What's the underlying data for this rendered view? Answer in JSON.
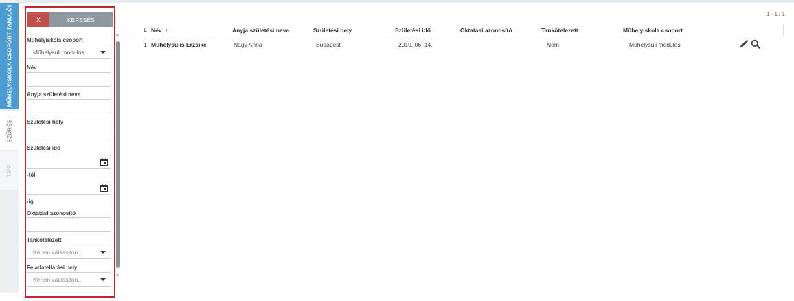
{
  "tabs": [
    {
      "label": "MŰHELYISKOLA CSOPORT TANULÓI"
    },
    {
      "label": "SZŰRÉS"
    },
    {
      "label": "TIPP"
    }
  ],
  "filter": {
    "clear_label": "X",
    "search_label": "KERESÉS",
    "group_label": "Műhelyiskola csoport",
    "group_value": "Műhelysuli modulos",
    "name_label": "Név",
    "mother_label": "Anyja születési neve",
    "birthplace_label": "Születési hely",
    "birthdate_label": "Születési idő",
    "from_label": "-tól",
    "to_label": "-ig",
    "eduid_label": "Oktatási azonosító",
    "compulsory_label": "Tankötelezett",
    "compulsory_placeholder": "Kérem válasszon...",
    "site_label": "Feladatellátási hely",
    "site_placeholder": "Kérem válasszon..."
  },
  "pager": "1 - 1 / 1",
  "table": {
    "headers": {
      "index": "#",
      "name": "Név",
      "sort_indicator": "↑",
      "mother": "Anyja születési neve",
      "birthplace": "Születési hely",
      "birthdate": "Születési idő",
      "eduid": "Oktatási azonosító",
      "compulsory": "Tankötelezett",
      "group": "Műhelyiskola csoport"
    },
    "rows": [
      {
        "index": "1",
        "name": "Műhelysulis Erzsike",
        "mother": "Nagy Anna",
        "birthplace": "Budapest",
        "birthdate": "2010. 06. 14.",
        "eduid": "",
        "compulsory": "Nem",
        "group": "Műhelysuli modulos"
      }
    ]
  },
  "icons": {
    "edit": "pencil-icon",
    "view": "magnifier-icon",
    "calendar": "calendar-icon",
    "dropdown": "caret-down-icon"
  },
  "colors": {
    "accent": "#4b9cd3",
    "clear_button": "#c0504d",
    "search_button": "#8f98a0",
    "highlight_border": "#c0272d"
  }
}
